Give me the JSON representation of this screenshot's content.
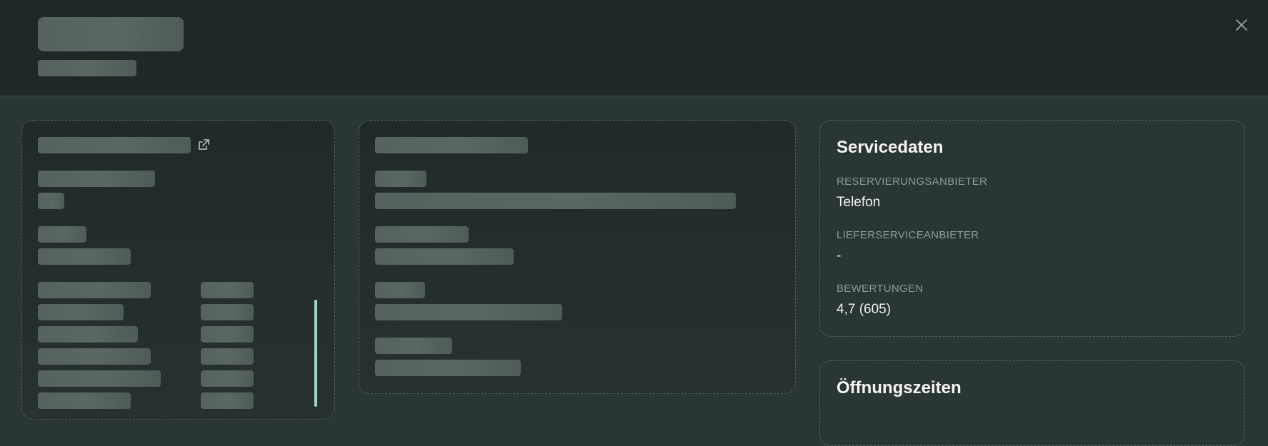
{
  "service_panel": {
    "title": "Servicedaten",
    "fields": [
      {
        "label": "RESERVIERUNGSANBIETER",
        "value": "Telefon"
      },
      {
        "label": "LIEFERSERVICEANBIETER",
        "value": "-"
      },
      {
        "label": "BEWERTUNGEN",
        "value": "4,7 (605)"
      }
    ]
  },
  "hours_panel": {
    "title": "Öffnungszeiten"
  },
  "icons": {
    "close": "close-icon",
    "external_link": "external-link-icon"
  },
  "colors": {
    "header_bg": "#1f2728",
    "body_bg": "#2a3536",
    "scroll_accent": "#9ed7c1"
  }
}
